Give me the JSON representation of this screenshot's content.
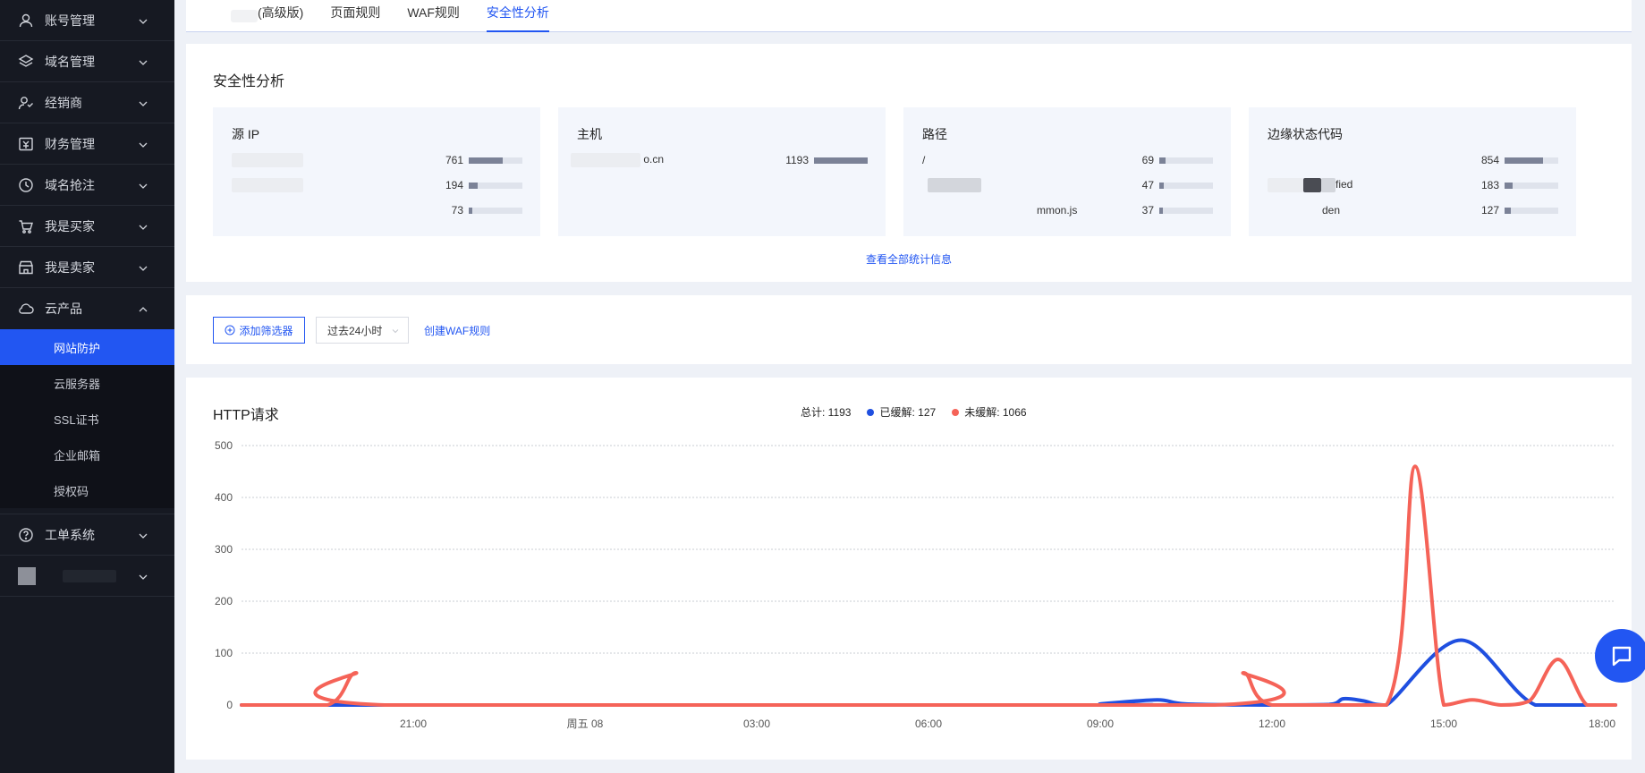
{
  "sidebar": {
    "items": [
      {
        "label": "账号管理",
        "icon": "user-icon"
      },
      {
        "label": "域名管理",
        "icon": "layers-icon"
      },
      {
        "label": "经销商",
        "icon": "dealer-icon"
      },
      {
        "label": "财务管理",
        "icon": "finance-icon"
      },
      {
        "label": "域名抢注",
        "icon": "clock-icon"
      },
      {
        "label": "我是买家",
        "icon": "cart-icon"
      },
      {
        "label": "我是卖家",
        "icon": "store-icon"
      },
      {
        "label": "云产品",
        "icon": "cloud-icon"
      }
    ],
    "cloud_sub": [
      "网站防护",
      "云服务器",
      "SSL证书",
      "企业邮箱",
      "授权码"
    ],
    "ticket": {
      "label": "工单系统",
      "icon": "question-icon"
    }
  },
  "tabs": [
    "(高级版)",
    "页面规则",
    "WAF规则",
    "安全性分析"
  ],
  "security": {
    "title": "安全性分析",
    "cards": [
      {
        "title": "源 IP",
        "rows": [
          {
            "label": "",
            "value": "761",
            "ratio": 0.64
          },
          {
            "label": "",
            "value": "194",
            "ratio": 0.16
          },
          {
            "label": "",
            "value": "73",
            "ratio": 0.06
          }
        ]
      },
      {
        "title": "主机",
        "rows": [
          {
            "label": "o.cn",
            "value": "1193",
            "ratio": 1.0
          }
        ]
      },
      {
        "title": "路径",
        "rows": [
          {
            "label": "/",
            "value": "69",
            "ratio": 0.12
          },
          {
            "label": "",
            "value": "47",
            "ratio": 0.08
          },
          {
            "label": "mmon.js",
            "value": "37",
            "ratio": 0.06
          }
        ]
      },
      {
        "title": "边缘状态代码",
        "rows": [
          {
            "label": "fied",
            "value": "854",
            "ratio": 0.72
          },
          {
            "label": "",
            "value": "183",
            "ratio": 0.15
          },
          {
            "label": "den",
            "value": "127",
            "ratio": 0.11
          }
        ]
      }
    ],
    "view_all": "查看全部统计信息"
  },
  "filter": {
    "add_filter": "添加筛选器",
    "range": "过去24小时",
    "create_rule": "创建WAF规则"
  },
  "chart_data": {
    "type": "line",
    "title": "HTTP请求",
    "totals": {
      "total_label": "总计: 1193",
      "cached_label": "已缓解: 127",
      "uncached_label": "未缓解: 1066"
    },
    "x_ticks": [
      "21:00",
      "周五 08",
      "03:00",
      "06:00",
      "09:00",
      "12:00",
      "15:00",
      "18:00"
    ],
    "y_ticks": [
      0,
      100,
      200,
      300,
      400,
      500
    ],
    "ylim": [
      0,
      500
    ],
    "xlim_hours": [
      0,
      24
    ],
    "series": [
      {
        "name": "已缓解",
        "color": "#1f4fe0",
        "points": [
          [
            0,
            0
          ],
          [
            14.8,
            0
          ],
          [
            15.0,
            2
          ],
          [
            16.0,
            10
          ],
          [
            16.5,
            2
          ],
          [
            18.0,
            0
          ],
          [
            19.0,
            1
          ],
          [
            19.25,
            12
          ],
          [
            19.6,
            8
          ],
          [
            20.0,
            0
          ],
          [
            21.3,
            125
          ],
          [
            22.6,
            0
          ],
          [
            24,
            0
          ]
        ]
      },
      {
        "name": "未缓解",
        "color": "#f56358",
        "points": [
          [
            0,
            0
          ],
          [
            1.5,
            0
          ],
          [
            2.0,
            62
          ],
          [
            2.5,
            0
          ],
          [
            17.0,
            0
          ],
          [
            17.5,
            62
          ],
          [
            18.0,
            0
          ],
          [
            20.0,
            0
          ],
          [
            20.5,
            460
          ],
          [
            21.0,
            0
          ],
          [
            21.5,
            10
          ],
          [
            22.0,
            0
          ],
          [
            22.5,
            8
          ],
          [
            23.0,
            88
          ],
          [
            23.5,
            0
          ],
          [
            24,
            0
          ]
        ]
      }
    ]
  },
  "colors": {
    "accent": "#2256f2",
    "cached": "#1f4fe0",
    "uncached": "#f56358"
  }
}
